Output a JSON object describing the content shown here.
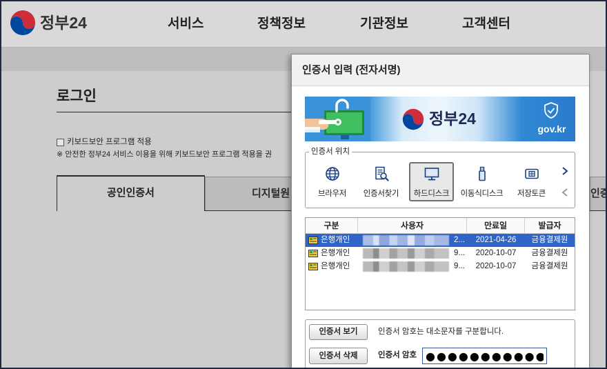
{
  "header": {
    "logo_text": "정부24",
    "logo_icon": "taegeuk-logo-icon",
    "nav": [
      {
        "label": "서비스"
      },
      {
        "label": "정책정보"
      },
      {
        "label": "기관정보"
      },
      {
        "label": "고객센터"
      }
    ]
  },
  "login": {
    "title": "로그인",
    "keyboard_security": {
      "label": "키보드보안 프로그램 적용",
      "checked": false
    },
    "notice": "※ 안전한 정부24 서비스 이용을 위해 키보드보안 프로그램 적용을 권",
    "tabs": [
      {
        "label": "공인인증서",
        "active": true
      },
      {
        "label": "디지털원",
        "active": false
      },
      {
        "label": "인증",
        "active": false
      }
    ]
  },
  "cert_dialog": {
    "title": "인증서 입력 (전자서명)",
    "banner": {
      "logo_text": "정부24",
      "domain": "gov.kr",
      "icons": [
        "hand-key-lock-illustration",
        "taegeuk-logo-icon",
        "shield-check-icon"
      ]
    },
    "location": {
      "legend": "인증서 위치",
      "items": [
        {
          "label": "브라우저",
          "icon": "globe-icon",
          "selected": false
        },
        {
          "label": "인증서찾기",
          "icon": "cert-search-icon",
          "selected": false
        },
        {
          "label": "하드디스크",
          "icon": "monitor-icon",
          "selected": true
        },
        {
          "label": "이동식디스크",
          "icon": "usb-drive-icon",
          "selected": false
        },
        {
          "label": "저장토큰",
          "icon": "security-token-icon",
          "selected": false
        }
      ],
      "scroll_icons": [
        "chevron-right-icon",
        "chevron-left-icon"
      ]
    },
    "table": {
      "columns": [
        "구분",
        "사용자",
        "만료일",
        "발급자"
      ],
      "rows": [
        {
          "type": "은행개인",
          "user_suffix": "2...",
          "expiry": "2021-04-26",
          "issuer": "금융결제원",
          "selected": true
        },
        {
          "type": "은행개인",
          "user_suffix": "9...",
          "expiry": "2020-10-07",
          "issuer": "금융결제원",
          "selected": false
        },
        {
          "type": "은행개인",
          "user_suffix": "9...",
          "expiry": "2020-10-07",
          "issuer": "금융결제원",
          "selected": false
        }
      ]
    },
    "actions": {
      "view_button": "인증서 보기",
      "delete_button": "인증서 삭제",
      "hint": "인증서 암호는 대소문자를 구분합니다.",
      "password_label": "인증서 암호",
      "password_value": "●●●●●●●●●●●●"
    }
  },
  "colors": {
    "selection": "#3164c8",
    "page_dim": "#cdcdcd",
    "header_dim": "#d9d9d9",
    "taegeuk_red": "#cd2e3a",
    "taegeuk_blue": "#0047a0",
    "banner_blue": "#2f86d3",
    "icon_navy": "#1c3f7c"
  }
}
